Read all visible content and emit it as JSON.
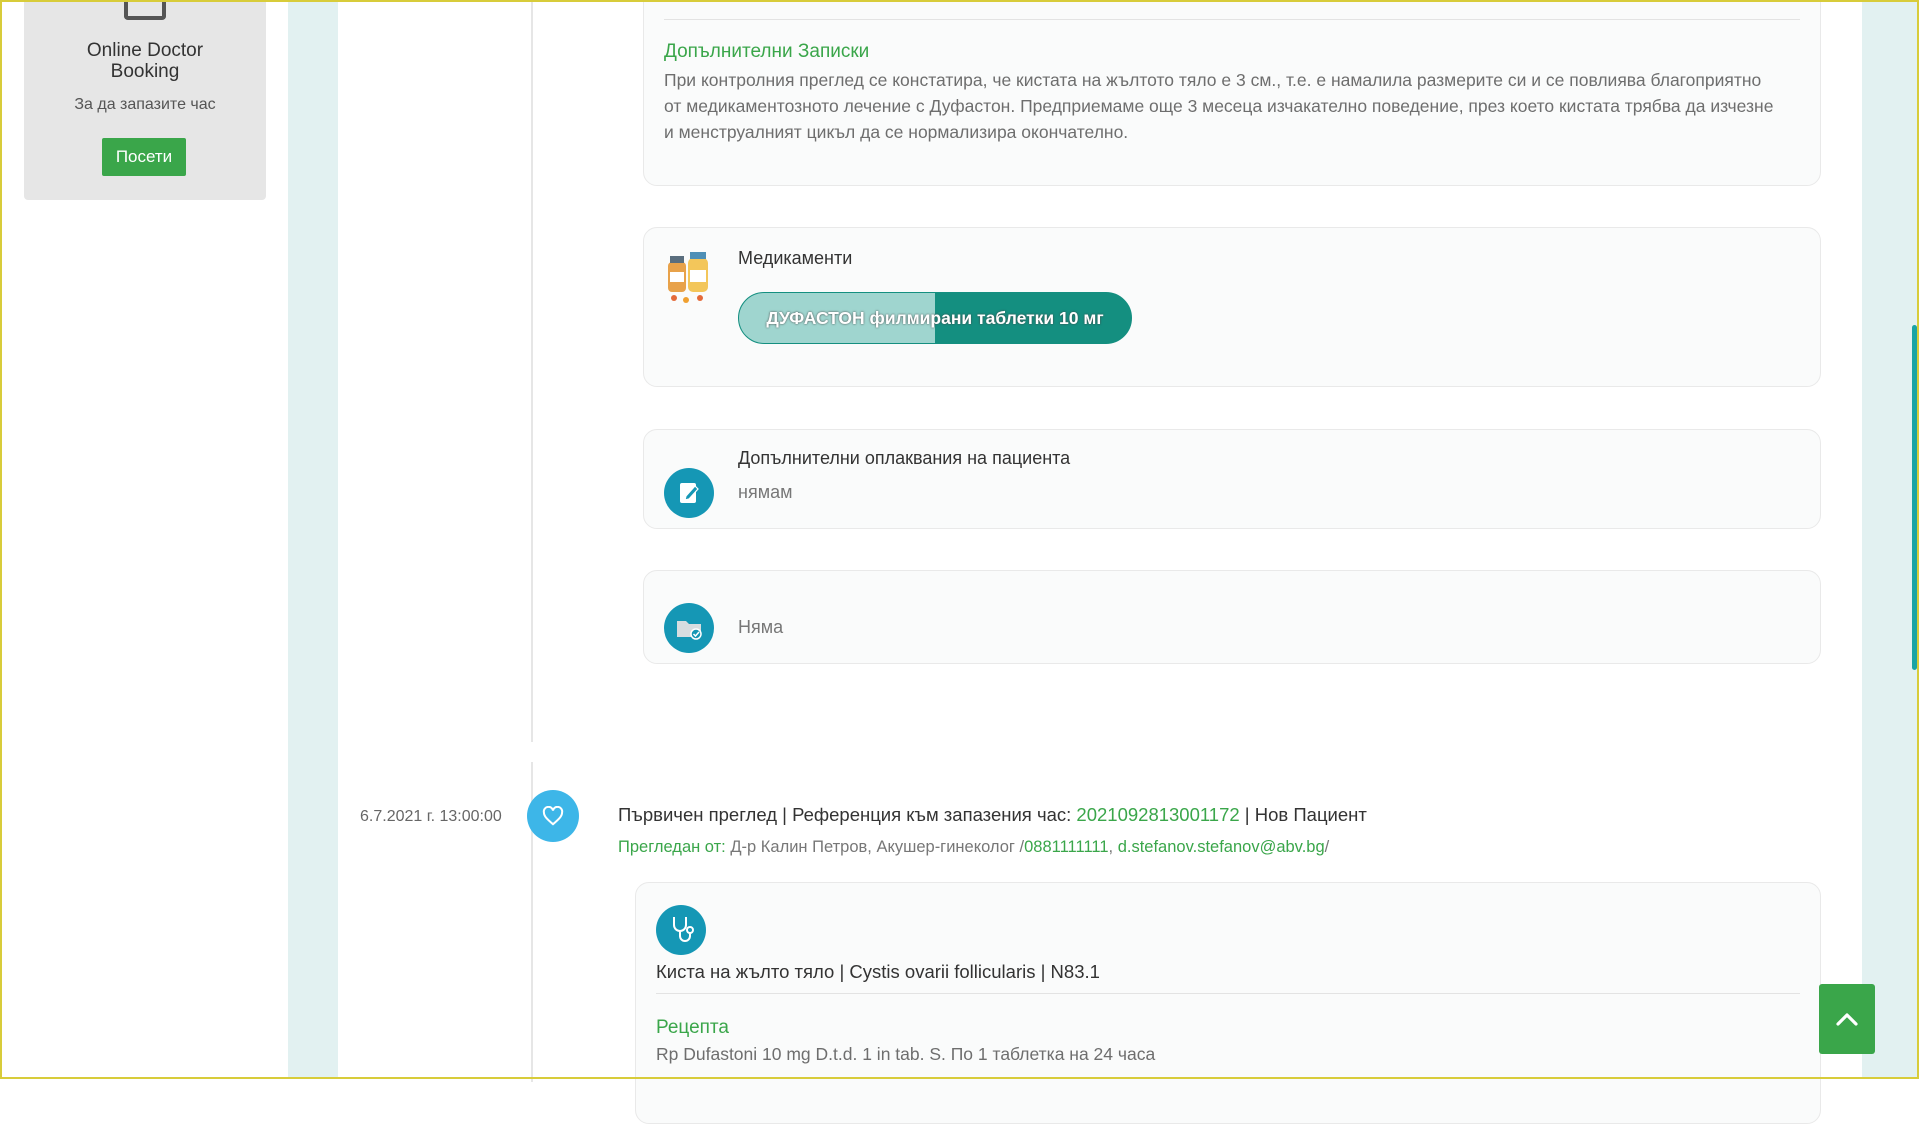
{
  "sidebar": {
    "booking": {
      "title": "Online Doctor Booking",
      "subtitle": "За да запазите час",
      "button": "Посети"
    }
  },
  "entry1": {
    "notes_title": "Допълнителни Записки",
    "notes_text": "При контролния преглед се констатира, че кистата на жълтото тяло е 3 см., т.е. е намалила размерите си и се повлиява благоприятно от медикаментозното лечение с Дуфастон. Предприемаме още 3 месеца изчакателно поведение, през което кистата трябва да изчезне и менструалният цикъл да се нормализира окончателно.",
    "medications_title": "Медикаменти",
    "medication": {
      "label": "ДУФАСТОН филмирани таблетки 10 мг",
      "progress": 0.5
    },
    "complaints_title": "Допълнителни оплаквания на пациента",
    "complaints_text": "нямам",
    "files_text": "Няма"
  },
  "entry2": {
    "date": "6.7.2021 г. 13:00:00",
    "head_prefix": "Първичен преглед | Референция към запазения час: ",
    "reference": "2021092813001172",
    "head_suffix": " | Нов Пациент",
    "examined_label": "Прегледан от:",
    "doctor": " Д-р Калин Петров, Акушер-гинеколог /",
    "phone": "0881111111",
    "sep": ", ",
    "email": "d.stefanov.stefanov@abv.bg",
    "slash": "/",
    "diagnosis": "Киста на жълто тяло | Cystis ovarii follicularis | N83.1",
    "rx_title": "Рецепта",
    "rx_text": "Rp Dufastoni 10 mg D.t.d. 1 in tab. S. По 1 таблетка на 24 часа"
  },
  "icons": {
    "heart": "heart-icon",
    "stethoscope": "stethoscope-icon",
    "edit": "edit-note-icon",
    "folder": "folder-check-icon",
    "pills": "pills-icon",
    "up": "chevron-up-icon"
  },
  "colors": {
    "green": "#3aa64a",
    "teal": "#148f80",
    "blue": "#1597b5",
    "heart": "#3db6e8"
  }
}
